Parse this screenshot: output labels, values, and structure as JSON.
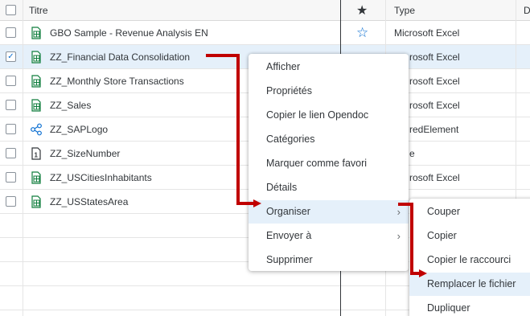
{
  "table": {
    "headers": {
      "title": "Titre",
      "favorite_star": "★",
      "type": "Type",
      "next_col": "D"
    },
    "rows": [
      {
        "title": "GBO Sample - Revenue Analysis EN",
        "type": "Microsoft Excel",
        "checked": false,
        "icon": "excel-file-icon"
      },
      {
        "title": "ZZ_Financial Data Consolidation",
        "type": "rosoft Excel",
        "checked": true,
        "icon": "excel-file-icon"
      },
      {
        "title": "ZZ_Monthly Store Transactions",
        "type": "rosoft Excel",
        "checked": false,
        "icon": "excel-file-icon"
      },
      {
        "title": "ZZ_Sales",
        "type": "rosoft Excel",
        "checked": false,
        "icon": "excel-file-icon"
      },
      {
        "title": "ZZ_SAPLogo",
        "type": "redElement",
        "checked": false,
        "icon": "share-icon"
      },
      {
        "title": "ZZ_SizeNumber",
        "type": "e",
        "checked": false,
        "icon": "number-file-icon"
      },
      {
        "title": "ZZ_USCitiesInhabitants",
        "type": "rosoft Excel",
        "checked": false,
        "icon": "excel-file-icon"
      },
      {
        "title": "ZZ_USStatesArea",
        "type": "",
        "checked": false,
        "icon": "excel-file-icon"
      }
    ],
    "star_glyph": "☆",
    "check_glyph": "✓"
  },
  "context_menu": {
    "items": [
      {
        "label": "Afficher"
      },
      {
        "label": "Propriétés"
      },
      {
        "label": "Copier le lien Opendoc"
      },
      {
        "label": "Catégories"
      },
      {
        "label": "Marquer comme favori"
      },
      {
        "label": "Détails"
      },
      {
        "label": "Organiser",
        "submenu": true,
        "highlighted": true
      },
      {
        "label": "Envoyer à",
        "submenu": true
      },
      {
        "label": "Supprimer"
      }
    ],
    "chevron": "›"
  },
  "submenu": {
    "items": [
      {
        "label": "Couper"
      },
      {
        "label": "Copier"
      },
      {
        "label": "Copier le raccourci"
      },
      {
        "label": "Remplacer le fichier",
        "highlighted": true
      },
      {
        "label": "Dupliquer"
      }
    ]
  },
  "colors": {
    "accent": "#0a6ed1",
    "excel_green": "#107e3e",
    "annotation_arrow": "#c00000",
    "selection": "#e5f0fa"
  }
}
